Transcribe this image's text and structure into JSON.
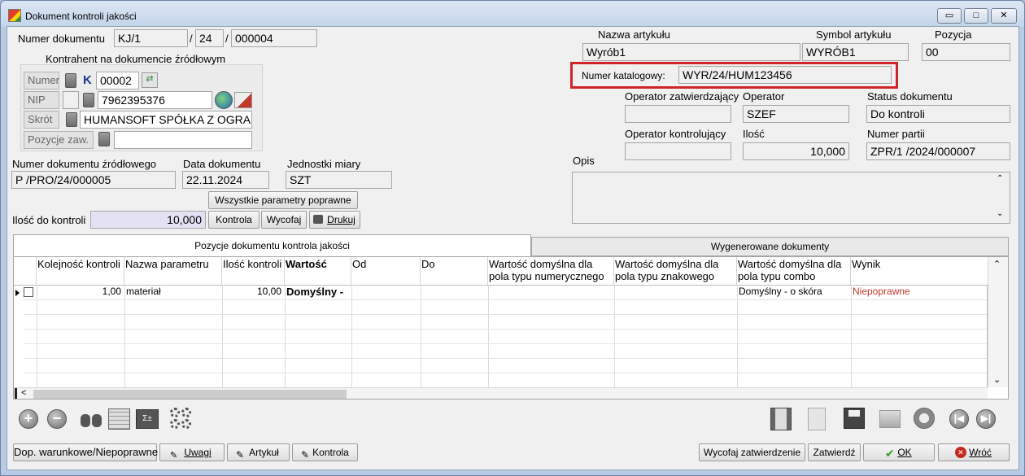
{
  "window": {
    "title": "Dokument kontroli jakości",
    "btn_min": "▭",
    "btn_max": "□",
    "btn_close": "✕"
  },
  "doc": {
    "numer_label": "Numer dokumentu",
    "numer1": "KJ/1",
    "sep1": "/",
    "numer2": "24",
    "sep2": "/",
    "numer3": "000004"
  },
  "kontrahent": {
    "group_label": "Kontrahent na dokumencie źródłowym",
    "numer_btn": "Numer",
    "numer_k": "K",
    "numer_val": "00002",
    "nip_btn": "NIP",
    "nip_val": "7962395376",
    "skrot_btn": "Skrót",
    "skrot_val": "HUMANSOFT SPÓŁKA Z OGRA",
    "pozycje_btn": "Pozycje zaw.",
    "pozycje_val": ""
  },
  "article": {
    "nazwa_label": "Nazwa artykułu",
    "nazwa_val": "Wyrób1",
    "symbol_label": "Symbol artykułu",
    "symbol_val": "WYRÓB1",
    "pozycja_label": "Pozycja",
    "pozycja_val": "00",
    "katalog_label": "Numer katalogowy:",
    "katalog_val": "WYR/24/HUM123456"
  },
  "ops": {
    "zatw_label": "Operator zatwierdzający",
    "zatw_val": "",
    "operator_label": "Operator",
    "operator_val": "SZEF",
    "status_label": "Status dokumentu",
    "status_val": "Do kontroli",
    "kontrol_label": "Operator kontrolujący",
    "kontrol_val": "",
    "ilosc_label": "Ilość",
    "ilosc_val": "10,000",
    "partia_label": "Numer partii",
    "partia_val": "ZPR/1 /2024/000007",
    "opis_label": "Opis",
    "opis_val": ""
  },
  "source": {
    "numer_zr_label": "Numer dokumentu źródłowego",
    "numer_zr_val": "P /PRO/24/000005",
    "data_label": "Data dokumentu",
    "data_val": "22.11.2024",
    "jm_label": "Jednostki miary",
    "jm_val": "SZT",
    "btn_all": "Wszystkie parametry poprawne",
    "ilosc_label": "Ilość do kontroli",
    "ilosc_val": "10,000",
    "btn_kontrola": "Kontrola",
    "btn_wycofaj": "Wycofaj",
    "btn_drukuj": "Drukuj"
  },
  "tabs": {
    "tab1": "Pozycje dokumentu kontrola jakości",
    "tab2": "Wygenerowane dokumenty"
  },
  "grid": {
    "headers": [
      "Kolejność kontroli",
      "Nazwa parametru",
      "Ilość kontroli",
      "Wartość",
      "Od",
      "Do",
      "Wartość domyślna dla pola typu numerycznego",
      "Wartość domyślna dla pola typu znakowego",
      "Wartość domyślna dla pola typu combo",
      "Wynik"
    ],
    "row": {
      "kolejnosc": "1,00",
      "nazwa": "materiał",
      "ilosc": "10,00",
      "wartosc": "Domyślny -",
      "od": "",
      "do": "",
      "numeric": "",
      "znakowy": "",
      "combo": "Domyślny - o skóra",
      "wynik": "Niepoprawne"
    },
    "wynik_color": "#c0392b"
  },
  "toolbar": {
    "add": "+",
    "remove": "−"
  },
  "bottom": {
    "dop": "Dop. warunkowe/Niepoprawne",
    "uwagi": "Uwagi",
    "artykul": "Artykuł",
    "kontrola": "Kontrola",
    "wycofaj_zatw": "Wycofaj zatwierdzenie",
    "zatwierdz": "Zatwierdź",
    "ok": "OK",
    "wroc": "Wróć"
  },
  "colors": {
    "highlight": "#d0242a",
    "ok_green": "#3b9b2f",
    "close_red": "#c42a1f"
  }
}
